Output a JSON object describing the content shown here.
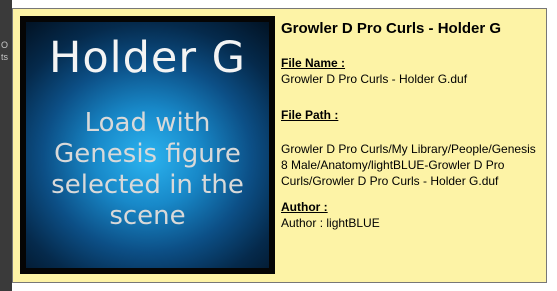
{
  "left_strip": {
    "glyph_1": "O",
    "glyph_2": "ts"
  },
  "thumbnail": {
    "title": "Holder G",
    "subtitle": "Load with\nGenesis figure\nselected in the\nscene"
  },
  "tooltip": {
    "heading": "Growler D Pro Curls - Holder G",
    "file_name_label": "File Name :",
    "file_name_value": "Growler D Pro Curls - Holder G.duf",
    "file_path_label": "File Path :",
    "file_path_value": "Growler D Pro Curls/My Library/People/Genesis 8 Male/Anatomy/lightBLUE-Growler D Pro Curls/Growler D Pro Curls - Holder G.duf",
    "author_label": "Author :",
    "author_value": "Author : lightBLUE"
  }
}
